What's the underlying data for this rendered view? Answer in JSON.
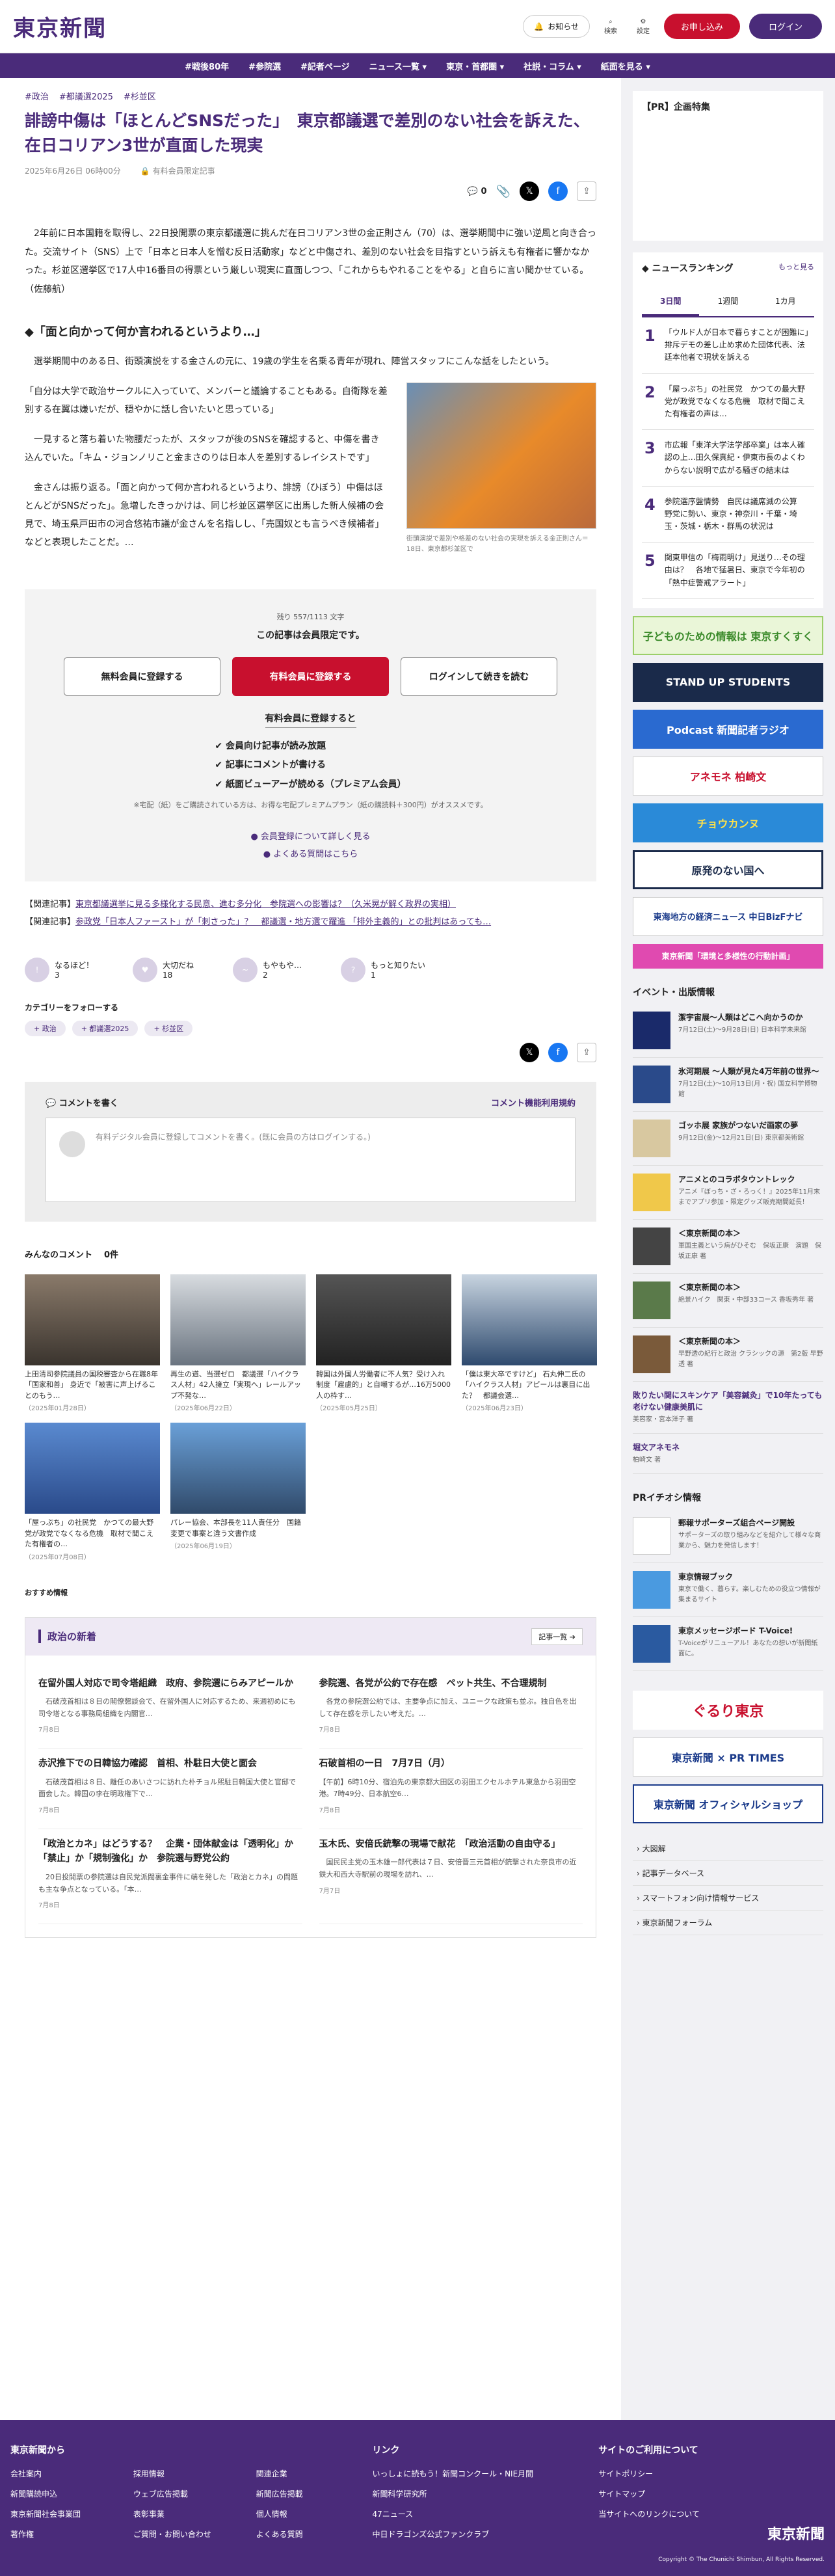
{
  "header": {
    "logo": "東京新聞",
    "notice": "お知らせ",
    "search": "検索",
    "settings": "設定",
    "apply": "お申し込み",
    "login": "ログイン"
  },
  "nav": [
    "#戦後80年",
    "#参院選",
    "#記者ページ",
    "ニュース一覧 ▾",
    "東京・首都圏 ▾",
    "社説・コラム ▾",
    "紙面を見る ▾"
  ],
  "article": {
    "tags": [
      "#政治",
      "#都議選2025",
      "#杉並区"
    ],
    "title": "誹謗中傷は「ほとんどSNSだった」　東京都議選で差別のない社会を訴えた、在日コリアン3世が直面した現実",
    "date": "2025年6月26日 06時00分",
    "badge": "有料会員限定記事",
    "comment_count": "0",
    "lead": "　2年前に日本国籍を取得し、22日投開票の東京都議選に挑んだ在日コリアン3世の金正則さん（70）は、選挙期間中に強い逆風と向き合った。交流サイト（SNS）上で「日本と日本人を憎む反日活動家」などと中傷され、差別のない社会を目指すという訴えも有権者に響かなかった。杉並区選挙区で17人中16番目の得票という厳しい現実に直面しつつ、「これからもやれることをやる」と自らに言い聞かせている。（佐藤航）",
    "h2": "◆「面と向かって何か言われるというより…」",
    "p1": "　選挙期間中のある日、街頭演説をする金さんの元に、19歳の学生を名乗る青年が現れ、陣営スタッフにこんな話をしたという。",
    "p2": "「自分は大学で政治サークルに入っていて、メンバーと議論することもある。自衛隊を差別する在翼は嫌いだが、穏やかに話し合いたいと思っている」",
    "p3": "　一見すると落ち着いた物腰だったが、スタッフが後のSNSを確認すると、中傷を書き込んでいた。「キム・ジョンノリこと金まさのりは日本人を差別するレイシストです」",
    "p4": "　金さんは振り返る。「面と向かって何か言われるというより、誹謗（ひぼう）中傷はほとんどがSNSだった」。急増したきっかけは、同じ杉並区選挙区に出馬した新人候補の会見で、埼玉県戸田市の河合悠祐市議が金さんを名指しし、「売国奴とも言うべき候補者」などと表現したことだ。…",
    "caption": "街頭演説で差別や格差のない社会の実現を訴える金正則さん＝18日、東京都杉並区で"
  },
  "paywall": {
    "remain": "残り 557/1113 文字",
    "note": "この記事は会員限定です。",
    "free": "無料会員に登録する",
    "paid": "有料会員に登録する",
    "login": "ログインして続きを読む",
    "benefit_title": "有料会員に登録すると",
    "benefits": [
      "✔ 会員向け記事が読み放題",
      "✔ 記事にコメントが書ける",
      "✔ 紙面ビューアーが読める（プレミアム会員）"
    ],
    "small": "※宅配（紙）をご購読されている方は、お得な宅配プレミアムプラン（紙の購読料＋300円）がオススメです。",
    "more1": "● 会員登録について詳しく見る",
    "more2": "● よくある質問はこちら"
  },
  "related": [
    {
      "label": "【関連記事】",
      "text": "東京都議選挙に見る多様化する民意、進む多分化　参院選への影響は？（久米晃が解く政界の実相）"
    },
    {
      "label": "【関連記事】",
      "text": "参政党「日本人ファースト」が「刺さった」？　都議選・地方選で躍進 「排外主義的」との批判はあっても…"
    }
  ],
  "reactions": [
    {
      "label": "なるほど！",
      "count": "3"
    },
    {
      "label": "大切だね",
      "count": "18"
    },
    {
      "label": "もやもや…",
      "count": "2"
    },
    {
      "label": "もっと知りたい",
      "count": "1"
    }
  ],
  "follow": {
    "title": "カテゴリーをフォローする",
    "chips": [
      "+ 政治",
      "+ 都議選2025",
      "+ 杉並区"
    ]
  },
  "comments": {
    "head": "コメントを書く",
    "rules": "コメント機能利用規約",
    "prompt": "有料デジタル会員に登録してコメントを書く。(既に会員の方はログインする。)",
    "all": "みんなのコメント",
    "count": "0件"
  },
  "thumbs": [
    {
      "t": "上田清司参院議員の国税審査から在職8年「国家和善」 身近で「被害に声上げることのもう…",
      "d": "（2025年01月28日）"
    },
    {
      "t": "再生の道、当選ゼロ　都議選「ハイクラス人材」42人擁立「実現へ」レールアップ不発な…",
      "d": "（2025年06月22日）"
    },
    {
      "t": "韓国は外国人労働者に不人気？受け入れ制度「雇慮的」と自嘲するが…16万5000人の枠す…",
      "d": "（2025年05月25日）"
    },
    {
      "t": "「僕は東大卒ですけど」 石丸伸二氏の「ハイクラス人材」アピールは裏目に出た？　都議会選…",
      "d": "（2025年06月23日）"
    },
    {
      "t": "「屋っぷち」の社民党　かつての最大野党が政党でなくなる危機　取材で聞こえた有権者の…",
      "d": "（2025年07月08日）"
    },
    {
      "t": "パレー協会、本部長を11人責任分　国籍変更で事案と違う文書作成",
      "d": "（2025年06月19日）"
    }
  ],
  "recommend": "おすすめ情報",
  "news": {
    "head": "政治の新着",
    "more": "記事一覧",
    "items": [
      {
        "t": "在留外国人対応で司令塔組織　政府、参院選にらみアピールか",
        "b": "　石破茂首相は８日の閣僚懇談会で、在留外国人に対応するため、来週初めにも司令塔となる事務局組織を内閣官…",
        "d": "7月8日"
      },
      {
        "t": "参院選、各党が公約で存在感　ペット共生、不合理規制",
        "b": "　各党の参院選公約では、主要争点に加え、ユニークな政策も並ぶ。独自色を出して存在感を示したい考えだ。…",
        "d": "7月8日"
      },
      {
        "t": "赤沢推下での日韓協力確認　首相、朴駐日大使と面会",
        "b": "　石破茂首相は８日、離任のあいさつに訪れた朴チョル煕駐日韓国大使と官邸で面会した。韓国の李在明政権下で…",
        "d": "7月8日"
      },
      {
        "t": "石破首相の一日　7月7日（月）",
        "b": "【午前】6時10分、宿泊先の東京都大田区の羽田エクセルホテル東急から羽田空港。7時49分、日本航空6…",
        "d": "7月8日"
      },
      {
        "t": "「政治とカネ」はどうする？　企業・団体献金は「透明化」か「禁止」か「規制強化」か　参院選与野党公約",
        "b": "　20日投開票の参院選は自民党派閥裏金事件に端を発した「政治とカネ」の問題も主な争点となっている。「本…",
        "d": "7月8日"
      },
      {
        "t": "玉木氏、安倍氏銃撃の現場で献花　「政治活動の自由守る」",
        "b": "　国民民主党の玉木雄一郎代表は７日、安倍晋三元首相が銃撃された奈良市の近鉄大和西大寺駅前の現場を訪れ、…",
        "d": "7月7日"
      }
    ]
  },
  "side": {
    "pr": "【PR】企画特集",
    "ranking": "ニュースランキング",
    "more": "もっと見る",
    "tabs": [
      "3日間",
      "1週間",
      "1カ月"
    ],
    "ranks": [
      {
        "n": "1",
        "t": "「ウルド人が日本で暮らすことが困難に」排斥デモの差し止め求めた団体代表、法廷本他者で現状を訴える"
      },
      {
        "n": "2",
        "t": "「屋っぷち」の社民党　かつての最大野党が政党でなくなる危機　取材で聞こえた有権者の声は…"
      },
      {
        "n": "3",
        "t": "市広報「東洋大学法学部卒業」は本人確認の上…田久保真紀・伊東市長のよくわからない説明で広がる騒ぎの結末は"
      },
      {
        "n": "4",
        "t": "参院選序盤情勢　自民は議席減の公算　野党に勢い、東京・神奈川・千葉・埼玉・茨城・栃木・群馬の状況は"
      },
      {
        "n": "5",
        "t": "関東甲信の「梅雨明け」見送り…その理由は？　各地で猛暑日、東京で今年初の「熱中症警戒アラート」"
      }
    ],
    "banners": [
      "子どものための情報は 東京すくすく",
      "STAND UP STUDENTS",
      "Podcast 新聞記者ラジオ",
      "アネモネ 柏崎文",
      "チョウカンヌ",
      "原発のない国へ",
      "東海地方の経済ニュース 中日BizFナビ",
      "東京新聞「環境と多様性の行動計画」"
    ],
    "events_title": "イベント・出版情報",
    "events": [
      {
        "t": "潔宇宙展〜人類はどこへ向かうのか",
        "d": "7月12日(土)〜9月28日(日) 日本科学未来館"
      },
      {
        "t": "氷河期展 〜人類が見た4万年前の世界〜",
        "d": "7月12日(土)〜10月13日(月・祝) 国立科学博物館"
      },
      {
        "t": "ゴッホ展 家族がつないだ画家の夢",
        "d": "9月12日(金)〜12月21日(日) 東京都美術館"
      },
      {
        "t": "アニメとのコラボタウントレック",
        "d": "アニメ『ぼっち・ざ・ろっく！』2025年11月末までアプリ参加・限定グッズ販売期間延長！"
      },
      {
        "t": "＜東京新聞の本＞",
        "d": "軍国主義という病がひそむ　保坂正康　演題　保坂正康 著"
      },
      {
        "t": "＜東京新聞の本＞",
        "d": "絶景ハイク　関東・中部33コース 香坂秀年 著"
      },
      {
        "t": "＜東京新聞の本＞",
        "d": "早野透の紀行と政治 クラシックの源　第2版 早野透 著"
      },
      {
        "t": "敗りたい関にスキンケア「美容鍼灸」で10年たっても老けない健康美肌に",
        "d": "美容家・宮本洋子 著"
      },
      {
        "t": "堀文アネモネ",
        "d": "柏崎文 著"
      }
    ],
    "pr2": "PRイチオシ情報",
    "pr_items": [
      {
        "t": "郵報サポーターズ組合ページ開設",
        "d": "サポーターズの取り組みなどを紹介して様々な商業から、魅力を発信します！"
      },
      {
        "t": "東京情報ブック",
        "d": "東京で働く、暮らす。楽しむための役立つ情報が集まるサイト"
      },
      {
        "t": "東京メッセージボード T-Voice!",
        "d": "T-Voiceがリニューアル！あなたの想いが新聞紙面に。"
      }
    ],
    "banners2": [
      "ぐるり東京",
      "東京新聞 × PR TIMES",
      "東京新聞 オフィシャルショップ"
    ],
    "links": [
      "大図解",
      "記事データベース",
      "スマートフォン向け情報サービス",
      "東京新聞フォーラム"
    ]
  },
  "footer": {
    "c1": "東京新聞から",
    "c1items": [
      "会社案内",
      "採用情報",
      "関連企業",
      "新聞購読申込",
      "ウェブ広告掲載",
      "新聞広告掲載",
      "東京新聞社会事業団",
      "表彰事業",
      "個人情報",
      "著作権",
      "ご質問・お問い合わせ",
      "よくある質問"
    ],
    "c2": "リンク",
    "c2items": [
      "いっしょに読もう！新聞コンクール・NIE月間",
      "新聞科学研究所",
      "47ニュース",
      "中日ドラゴンズ公式ファンクラブ"
    ],
    "c3": "サイトのご利用について",
    "c3items": [
      "サイトポリシー",
      "サイトマップ",
      "当サイトへのリンクについて"
    ],
    "logo": "東京新聞",
    "copyright": "Copyright © The Chunichi Shimbun, All Rights Reserved."
  }
}
